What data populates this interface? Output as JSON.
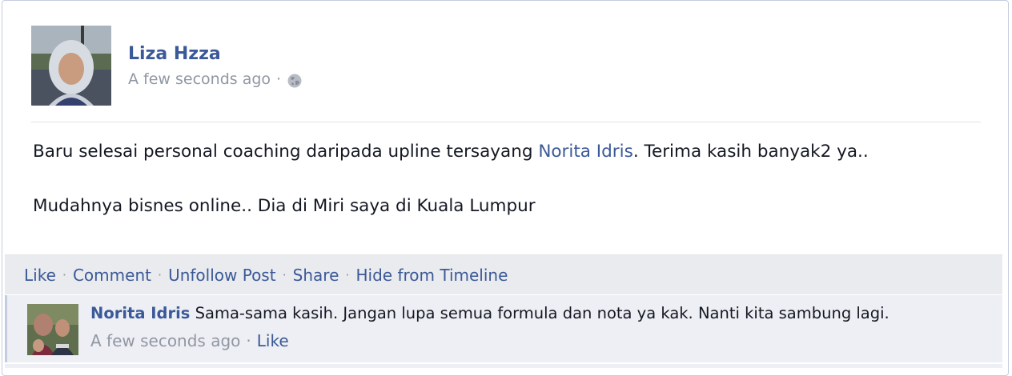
{
  "post": {
    "author": "Liza Hzza",
    "timestamp": "A few seconds ago",
    "separator": "·",
    "privacy_icon": "globe-icon",
    "text_line1_before": "Baru selesai personal coaching daripada upline tersayang ",
    "text_mention": "Norita Idris",
    "text_line1_after": ". Terima kasih banyak2 ya..",
    "text_line2": "Mudahnya bisnes online.. Dia di Miri saya di Kuala Lumpur"
  },
  "actions": {
    "like": "Like",
    "comment": "Comment",
    "unfollow": "Unfollow Post",
    "share": "Share",
    "hide": "Hide from Timeline",
    "separator": "·"
  },
  "comment": {
    "author": "Norita Idris",
    "text": " Sama-sama kasih. Jangan lupa semua formula dan nota ya kak. Nanti kita sambung lagi.",
    "timestamp": "A few seconds ago",
    "separator": "·",
    "like": "Like"
  },
  "colors": {
    "link": "#3b5998",
    "muted": "#9197a3",
    "action_bar": "#e9ebee",
    "comment_bg": "#edeff4"
  }
}
